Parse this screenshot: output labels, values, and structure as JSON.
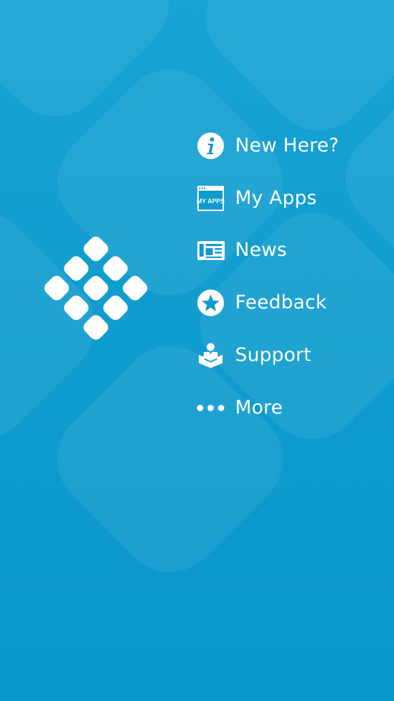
{
  "theme": {
    "background": "#0e9bcd",
    "foreground": "#ffffff"
  },
  "logo": {
    "icon": "app-grid-logo-icon"
  },
  "menu": {
    "items": [
      {
        "label": "New Here?",
        "icon": "info-icon"
      },
      {
        "label": "My Apps",
        "icon": "my-apps-icon",
        "icon_text": "MY APPS"
      },
      {
        "label": "News",
        "icon": "newspaper-icon"
      },
      {
        "label": "Feedback",
        "icon": "star-icon"
      },
      {
        "label": "Support",
        "icon": "support-icon"
      },
      {
        "label": "More",
        "icon": "more-dots-icon"
      }
    ]
  }
}
